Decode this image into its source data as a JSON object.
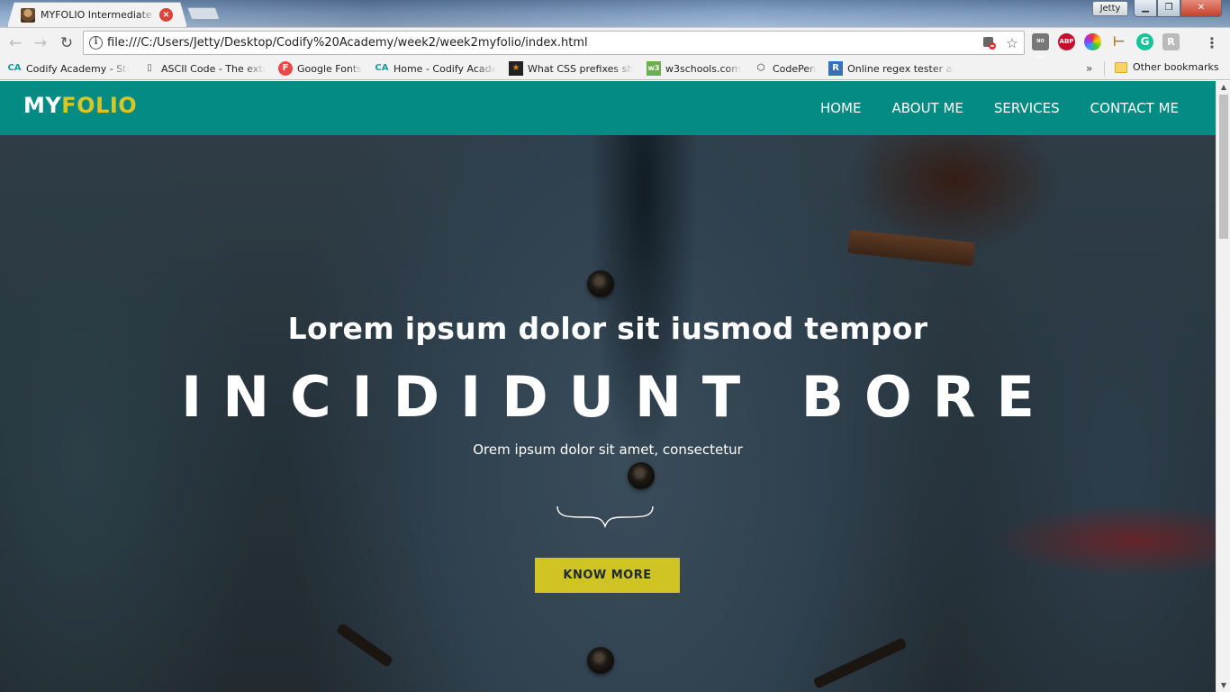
{
  "browser": {
    "tab_title": "MYFOLIO Intermediate W",
    "tab_close": "×",
    "profile_name": "Jetty",
    "window_controls": {
      "minimize": "▁",
      "maximize": "❐",
      "close": "✕"
    },
    "nav": {
      "back": "←",
      "forward": "→",
      "reload": "↻"
    },
    "url": "file:///C:/Users/Jetty/Desktop/Codify%20Academy/week2/week2myfolio/index.html",
    "info_icon": "i",
    "star_icon": "☆",
    "extensions": {
      "noads": "NO ADS",
      "abp": "ABP",
      "tool": "⊢",
      "grammarly": "G",
      "reader": "R"
    },
    "menu": "⋮"
  },
  "bookmarks": {
    "items": [
      {
        "icon": "CA",
        "icon_color": "#1a9c9c",
        "label": "Codify Academy - Stu"
      },
      {
        "icon": "▯",
        "icon_color": "#555555",
        "label": "ASCII Code - The exte"
      },
      {
        "icon": "F",
        "icon_color": "#e84a4a",
        "label": "Google Fonts"
      },
      {
        "icon": "CA",
        "icon_color": "#1a9c9c",
        "label": "Home - Codify Acade"
      },
      {
        "icon": "★",
        "icon_color": "#e07b12",
        "label": "What CSS prefixes sho"
      },
      {
        "icon": "w3",
        "icon_color": "#6ab04c",
        "label": "w3schools.com"
      },
      {
        "icon": "⬡",
        "icon_color": "#222222",
        "label": "CodePen"
      },
      {
        "icon": "R",
        "icon_color": "#3d6fb6",
        "label": "Online regex tester an"
      }
    ],
    "overflow": "»",
    "other_label": "Other bookmarks"
  },
  "site": {
    "logo_my": "MY",
    "logo_folio": "FOLIO",
    "nav": [
      "HOME",
      "ABOUT ME",
      "SERVICES",
      "CONTACT ME"
    ],
    "hero": {
      "subtitle": "Lorem ipsum dolor sit iusmod tempor",
      "title": "INCIDIDUNT BORE",
      "tagline": "Orem ipsum dolor sit amet, consectetur",
      "button": "KNOW MORE"
    }
  },
  "scrollbar": {
    "up": "▲",
    "down": "▼"
  },
  "colors": {
    "nav_bg": "#038b84",
    "accent": "#d4c72a",
    "button_bg": "#cfc423"
  }
}
